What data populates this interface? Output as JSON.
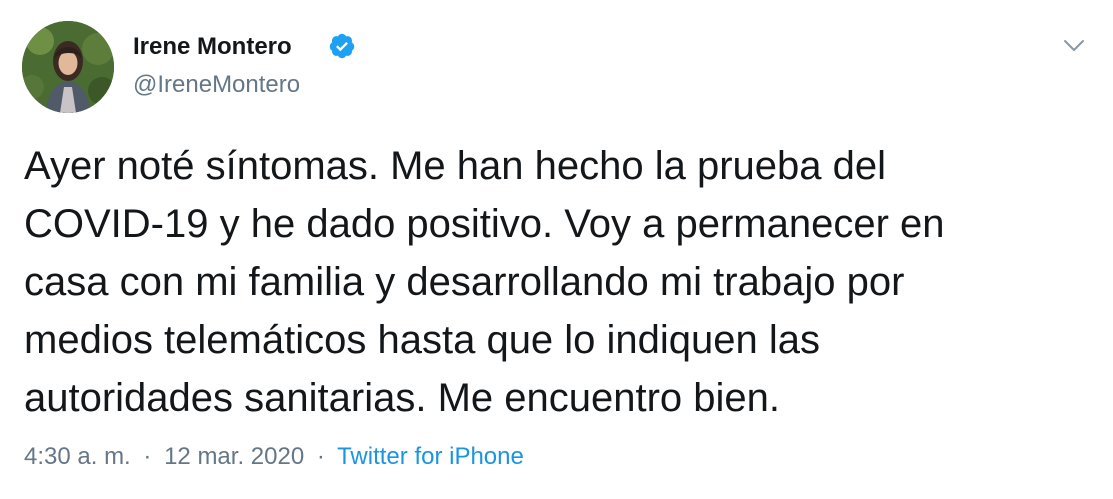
{
  "author": {
    "name": "Irene Montero",
    "handle": "@IreneMontero",
    "verified": true
  },
  "tweet": {
    "text": "Ayer noté síntomas. Me han hecho la prueba del\nCOVID-19 y he dado positivo. Voy a permanecer en\ncasa con mi familia y desarrollando mi trabajo por\nmedios telemáticos hasta que lo indiquen las\nautoridades sanitarias. Me encuentro bien.",
    "time": "4:30 a. m.",
    "separator": "·",
    "date": "12 mar. 2020",
    "source": "Twitter for iPhone"
  },
  "icons": {
    "verified": "verified-badge-icon",
    "caret": "chevron-down-icon"
  },
  "colors": {
    "text": "#14171a",
    "secondary": "#657786",
    "link": "#1b95e0",
    "verified": "#1da1f2",
    "background": "#ffffff"
  }
}
